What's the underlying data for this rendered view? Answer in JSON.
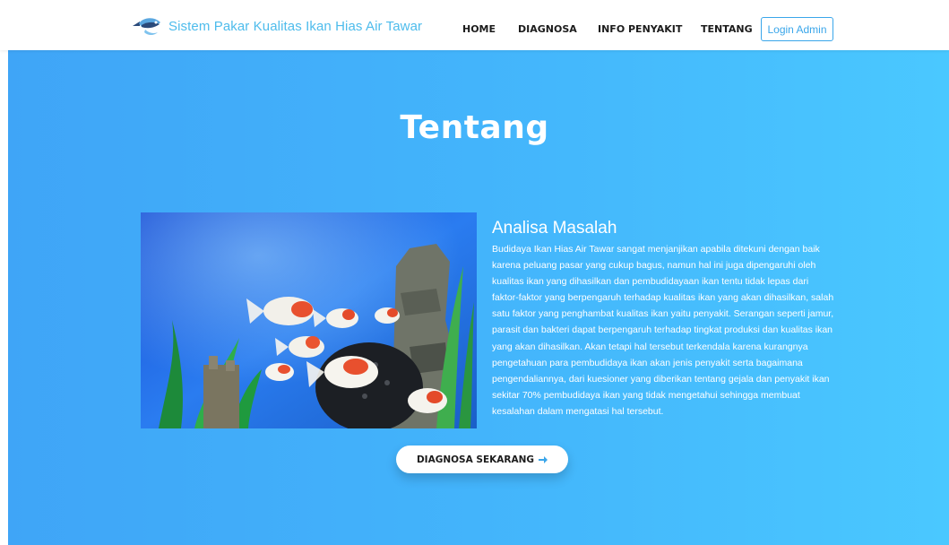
{
  "brand": {
    "name": "Sistem Pakar Kualitas Ikan Hias Air Tawar",
    "logo_icon": "fish-logo-icon"
  },
  "nav": {
    "items": [
      {
        "label": "HOME"
      },
      {
        "label": "DIAGNOSA"
      },
      {
        "label": "INFO PENYAKIT"
      },
      {
        "label": "TENTANG"
      }
    ],
    "login_label": "Login Admin"
  },
  "hero": {
    "title": "Tentang",
    "section_heading": "Analisa Masalah",
    "section_body": "Budidaya Ikan Hias Air Tawar sangat menjanjikan apabila ditekuni dengan baik karena peluang pasar yang cukup bagus, namun hal ini juga dipengaruhi oleh kualitas ikan yang dihasilkan dan pembudidayaan ikan tentu tidak lepas dari faktor-faktor yang berpengaruh terhadap kualitas ikan yang akan dihasilkan, salah satu faktor yang penghambat kualitas ikan yaitu penyakit. Serangan seperti jamur, parasit dan bakteri dapat berpengaruh terhadap tingkat produksi dan kualitas ikan yang akan dihasilkan. Akan tetapi hal tersebut terkendala karena kurangnya pengetahuan para pembudidaya ikan akan jenis penyakit serta bagaimana pengendaliannya, dari kuesioner yang diberikan tentang gejala dan penyakit ikan sekitar 70% pembudidaya ikan yang tidak mengetahui sehingga membuat kesalahan dalam mengatasi hal tersebut.",
    "cta_label": "DIAGNOSA SEKARANG",
    "cta_icon": "arrow-right-icon"
  },
  "colors": {
    "brand_text": "#4ebcec",
    "accent": "#3aa6ea",
    "hero_gradient_start": "#3fa5f7",
    "hero_gradient_end": "#4ac8ff"
  }
}
